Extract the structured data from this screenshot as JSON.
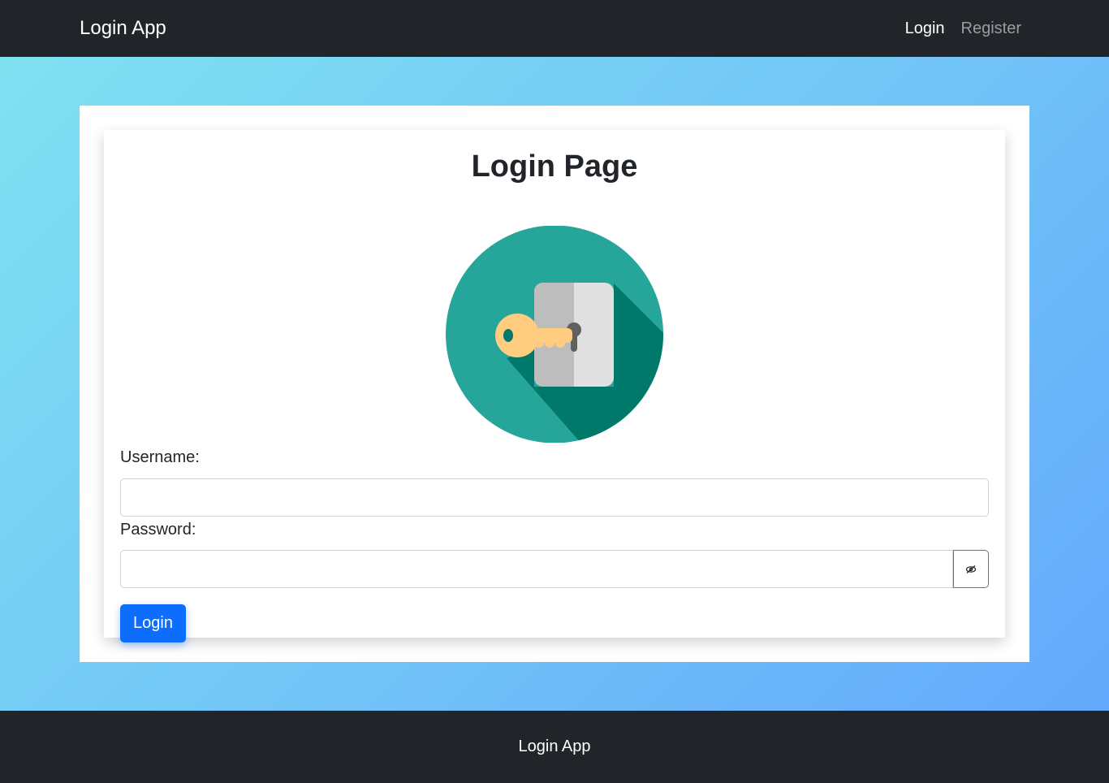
{
  "navbar": {
    "brand": "Login App",
    "links": [
      {
        "label": "Login"
      },
      {
        "label": "Register"
      }
    ]
  },
  "main": {
    "title": "Login Page",
    "logo_icon": "key-lock-icon",
    "username_label": "Username:",
    "username_value": "",
    "password_label": "Password:",
    "password_value": "",
    "toggle_icon": "eye-slash-icon",
    "submit_label": "Login"
  },
  "footer": {
    "text": "Login App"
  },
  "colors": {
    "navbar_bg": "#212529",
    "primary": "#0d6efd",
    "logo_teal": "#26a69a",
    "logo_shadow": "#00796b",
    "key_gold": "#ffcc80"
  }
}
